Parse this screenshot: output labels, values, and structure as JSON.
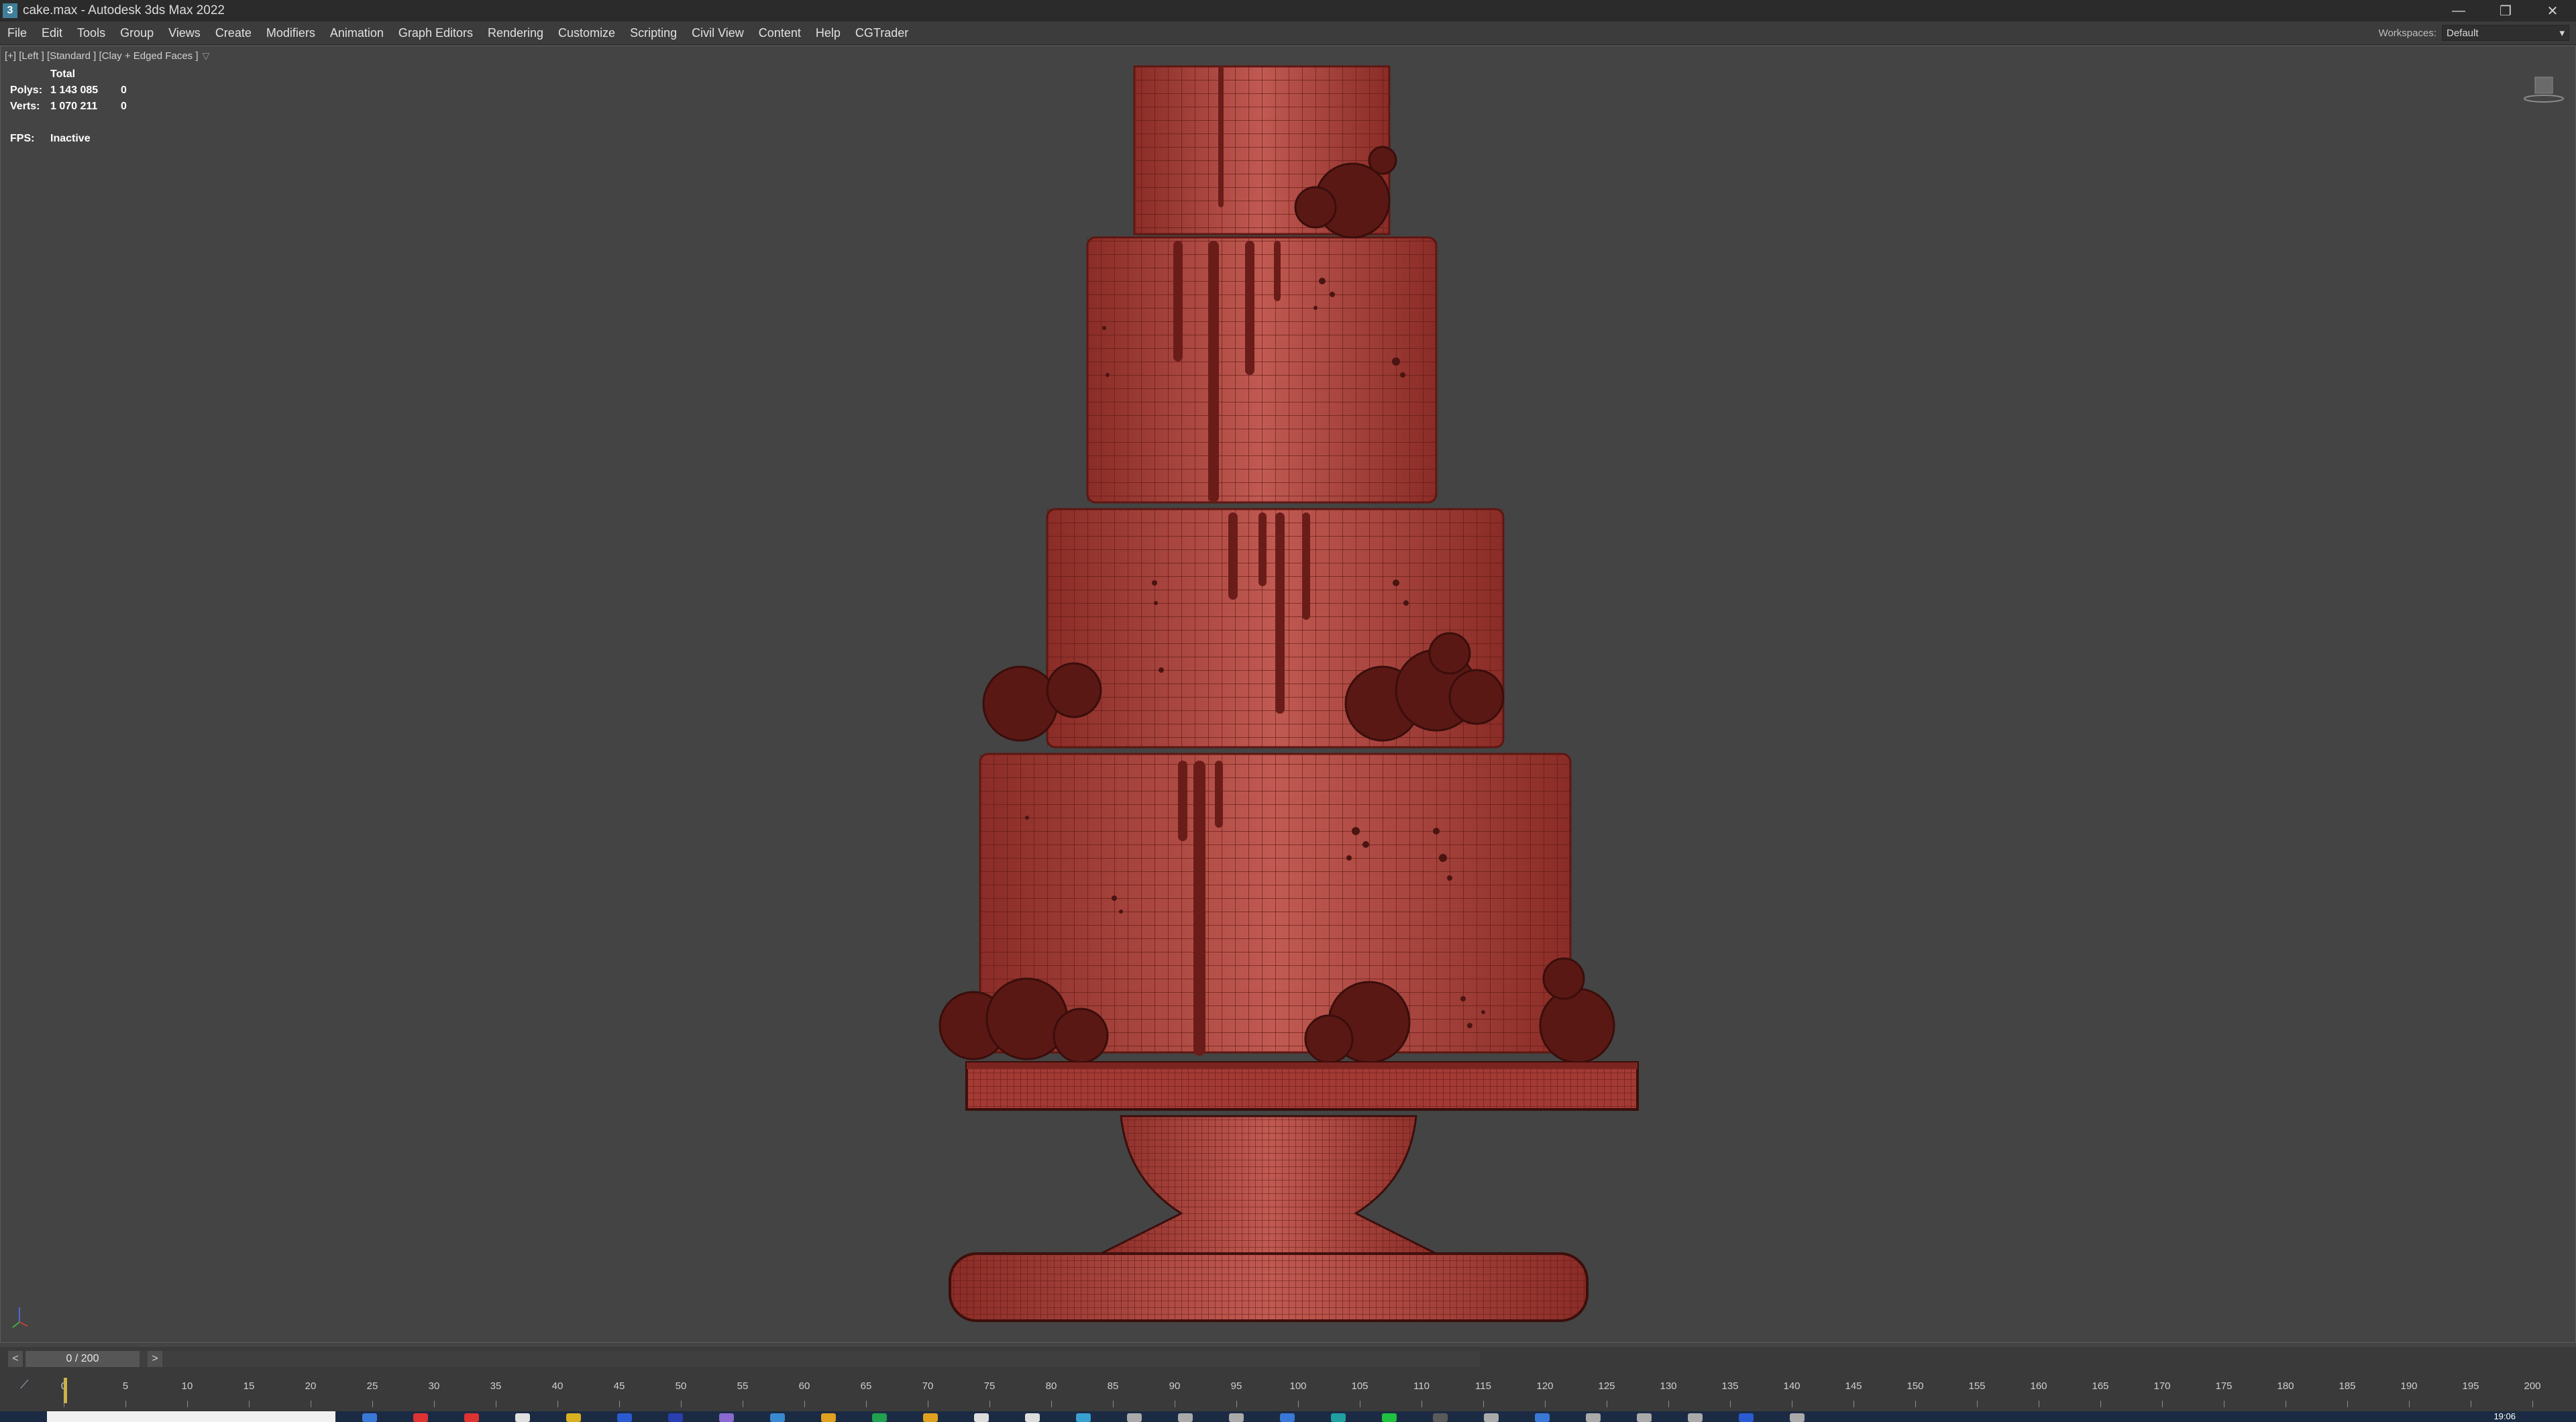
{
  "window": {
    "title": "cake.max - Autodesk 3ds Max 2022",
    "app_icon": "3",
    "controls": [
      "—",
      "❐",
      "✕"
    ]
  },
  "menu": {
    "items": [
      "File",
      "Edit",
      "Tools",
      "Group",
      "Views",
      "Create",
      "Modifiers",
      "Animation",
      "Graph Editors",
      "Rendering",
      "Customize",
      "Scripting",
      "Civil View",
      "Content",
      "Help",
      "CGTrader"
    ]
  },
  "workspaces": {
    "label": "Workspaces:",
    "value": "Default"
  },
  "viewport": {
    "label": "[+] [Left ] [Standard ] [Clay + Edged Faces ]",
    "stats": {
      "header": "Total",
      "polys_label": "Polys:",
      "polys_value": "1 143 085",
      "polys_sel": "0",
      "verts_label": "Verts:",
      "verts_value": "1 070 211",
      "verts_sel": "0",
      "fps_label": "FPS:",
      "fps_value": "Inactive"
    }
  },
  "timeline": {
    "prev": "<",
    "next": ">",
    "frame_display": "0 / 200",
    "current_frame": 0,
    "total_frames": 200,
    "ruler_labels": [
      "0",
      "5",
      "10",
      "15",
      "20",
      "25",
      "30",
      "35",
      "40",
      "45",
      "50",
      "55",
      "60",
      "65",
      "70",
      "75",
      "80",
      "85",
      "90",
      "95",
      "100",
      "105",
      "110",
      "115",
      "120",
      "125",
      "130",
      "135",
      "140",
      "145",
      "150",
      "155",
      "160",
      "165",
      "170",
      "175",
      "180",
      "185",
      "190",
      "195",
      "200"
    ]
  },
  "taskbar": {
    "clock": "19:06"
  },
  "colors": {
    "viewport_bg": "#444444",
    "cake_fill": "#a33a34",
    "cake_wire": "#5e1712",
    "time_cursor": "#c9b34a"
  }
}
